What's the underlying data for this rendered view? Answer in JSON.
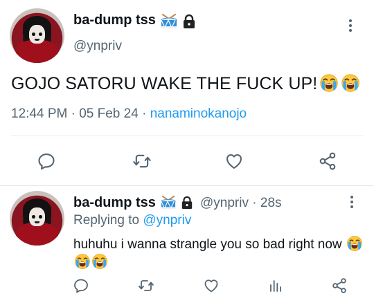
{
  "main_tweet": {
    "display_name": "ba-dump tss",
    "handle": "@ynpriv",
    "text": "GOJO SATORU WAKE THE FUCK UP!",
    "emojis": [
      "loudly-crying-face",
      "loudly-crying-face"
    ],
    "time": "12:44 PM",
    "dot1": "·",
    "date": "05 Feb 24",
    "dot2": "·",
    "client": "nanaminokanojo",
    "actions": [
      "reply-icon",
      "retweet-icon",
      "like-icon",
      "share-icon"
    ]
  },
  "reply_tweet": {
    "display_name": "ba-dump tss",
    "handle": "@ynpriv",
    "time_sep": "·",
    "age": "28s",
    "replying_to_label": "Replying to",
    "replying_to_handle": "@ynpriv",
    "text": "huhuhu i wanna strangle you so bad right now",
    "emojis": [
      "loudly-crying-face",
      "loudly-crying-face",
      "loudly-crying-face"
    ],
    "actions": [
      "reply-icon",
      "retweet-icon",
      "like-icon",
      "views-icon",
      "share-icon"
    ]
  },
  "badges": [
    "drum-emoji",
    "lock-icon"
  ],
  "colors": {
    "accent": "#1d9bf0",
    "secondary_text": "#536471",
    "divider": "#e3e7ea",
    "icon": "#536471"
  }
}
